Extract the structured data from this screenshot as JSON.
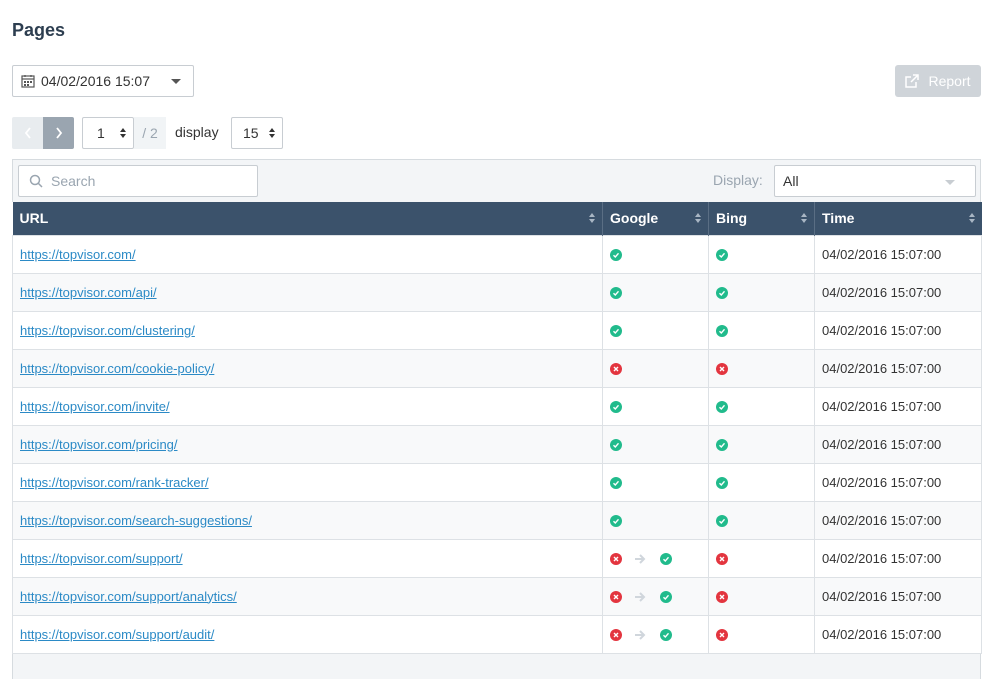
{
  "page": {
    "title": "Pages"
  },
  "toolbar": {
    "date_value": "04/02/2016 15:07",
    "report_label": "Report"
  },
  "pager": {
    "current_page": "1",
    "total_pages": "/ 2",
    "display_label": "display",
    "per_page": "15"
  },
  "filters": {
    "search_placeholder": "Search",
    "display_label": "Display:",
    "display_value": "All"
  },
  "table": {
    "columns": [
      "URL",
      "Google",
      "Bing",
      "Time"
    ],
    "rows": [
      {
        "url": "https://topvisor.com/",
        "google": "ok",
        "bing": "ok",
        "time": "04/02/2016 15:07:00"
      },
      {
        "url": "https://topvisor.com/api/",
        "google": "ok",
        "bing": "ok",
        "time": "04/02/2016 15:07:00"
      },
      {
        "url": "https://topvisor.com/clustering/",
        "google": "ok",
        "bing": "ok",
        "time": "04/02/2016 15:07:00"
      },
      {
        "url": "https://topvisor.com/cookie-policy/",
        "google": "fail",
        "bing": "fail",
        "time": "04/02/2016 15:07:00"
      },
      {
        "url": "https://topvisor.com/invite/",
        "google": "ok",
        "bing": "ok",
        "time": "04/02/2016 15:07:00"
      },
      {
        "url": "https://topvisor.com/pricing/",
        "google": "ok",
        "bing": "ok",
        "time": "04/02/2016 15:07:00"
      },
      {
        "url": "https://topvisor.com/rank-tracker/",
        "google": "ok",
        "bing": "ok",
        "time": "04/02/2016 15:07:00"
      },
      {
        "url": "https://topvisor.com/search-suggestions/",
        "google": "ok",
        "bing": "ok",
        "time": "04/02/2016 15:07:00"
      },
      {
        "url": "https://topvisor.com/support/",
        "google": "fail-to-ok",
        "bing": "fail",
        "time": "04/02/2016 15:07:00"
      },
      {
        "url": "https://topvisor.com/support/analytics/",
        "google": "fail-to-ok",
        "bing": "fail",
        "time": "04/02/2016 15:07:00"
      },
      {
        "url": "https://topvisor.com/support/audit/",
        "google": "fail-to-ok",
        "bing": "fail",
        "time": "04/02/2016 15:07:00"
      }
    ]
  },
  "colors": {
    "header_bg": "#3b526b",
    "ok": "#21bb8c",
    "fail": "#e3353f",
    "link": "#2b8ac6",
    "title": "#2d3e50"
  },
  "icons": {
    "date": "calendar-icon",
    "report": "export-icon",
    "search": "search-icon",
    "ok": "check-circle-icon",
    "fail": "x-circle-icon",
    "change": "arrow-right-icon"
  }
}
